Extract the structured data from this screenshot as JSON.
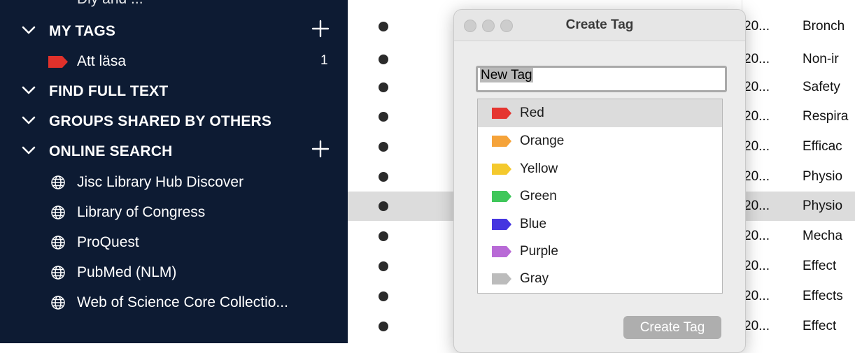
{
  "sidebar": {
    "partial_top_text": "Diy and ...",
    "sections": {
      "my_tags": {
        "label": "MY TAGS",
        "items": [
          {
            "label": "Att läsa",
            "count": "1",
            "tag_color": "#e0312b"
          }
        ]
      },
      "find_full_text": {
        "label": "FIND FULL TEXT"
      },
      "groups_shared": {
        "label": "GROUPS SHARED BY OTHERS"
      },
      "online_search": {
        "label": "ONLINE SEARCH",
        "items": [
          {
            "label": "Jisc Library Hub Discover",
            "icon": "globe-icon"
          },
          {
            "label": "Library of Congress",
            "icon": "globe-icon"
          },
          {
            "label": "ProQuest",
            "icon": "globe-icon"
          },
          {
            "label": "PubMed (NLM)",
            "icon": "globe-icon"
          },
          {
            "label": "Web of Science Core Collectio...",
            "icon": "globe-icon"
          }
        ]
      }
    }
  },
  "references": {
    "rows": [
      {
        "year": "20...",
        "title": "Bronch"
      },
      {
        "year": "20...",
        "title": "Non-ir"
      },
      {
        "year": "20...",
        "title": "Safety"
      },
      {
        "year": "20...",
        "title": "Respira"
      },
      {
        "year": "20...",
        "title": "Efficac"
      },
      {
        "year": "20...",
        "title": "Physio"
      },
      {
        "year": "20...",
        "title": "Physio",
        "selected": true
      },
      {
        "year": "20...",
        "title": "Mecha"
      },
      {
        "year": "20...",
        "title": "Effect"
      },
      {
        "year": "20...",
        "title": "Effects"
      },
      {
        "year": "20...",
        "title": "Effect"
      }
    ]
  },
  "dialog": {
    "title": "Create Tag",
    "name_value": "New Tag",
    "create_button_label": "Create Tag",
    "colors": [
      {
        "label": "Red",
        "hex": "#e53530",
        "selected": true
      },
      {
        "label": "Orange",
        "hex": "#f5a33a"
      },
      {
        "label": "Yellow",
        "hex": "#f4c92d"
      },
      {
        "label": "Green",
        "hex": "#3fc75a"
      },
      {
        "label": "Blue",
        "hex": "#4535e0"
      },
      {
        "label": "Purple",
        "hex": "#b86ad6"
      },
      {
        "label": "Gray",
        "hex": "#bcbcbc"
      }
    ]
  },
  "theme": {
    "sidebar_bg": "#0d1b33",
    "selection_bg": "#dcdcdc",
    "accent_plus": "#ffffff"
  }
}
